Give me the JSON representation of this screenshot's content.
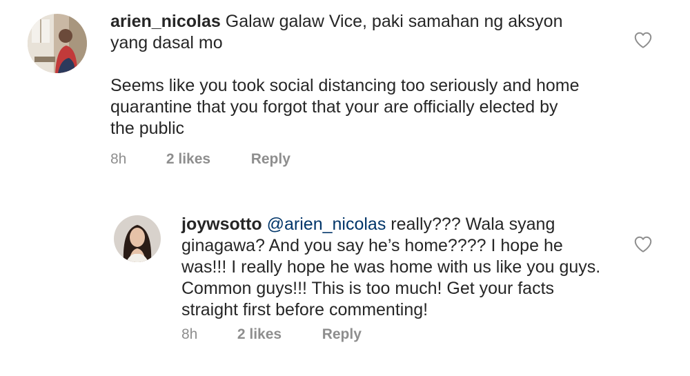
{
  "comments": [
    {
      "username": "arien_nicolas",
      "text_lines_1": "Galaw galaw Vice, paki samahan ng aksyon yang dasal mo",
      "text_lines_2": "Seems like you took social distancing too seriously and home quarantine that you forgot that your are officially elected by the public",
      "time": "8h",
      "likes": "2 likes",
      "reply_label": "Reply",
      "like_icon": "heart-outline-icon"
    },
    {
      "username": "joywsotto",
      "mention": "@arien_nicolas",
      "text": "really??? Wala syang ginagawa? And you say he’s home???? I hope he was!!! I really hope he was home with us like you guys. Common guys!!! This is too much! Get your facts straight first before commenting!",
      "time": "8h",
      "likes": "2 likes",
      "reply_label": "Reply",
      "like_icon": "heart-outline-icon"
    }
  ],
  "colors": {
    "text": "#262626",
    "meta": "#8e8e8e",
    "mention": "#003569",
    "heart_stroke": "#8e8e8e"
  }
}
